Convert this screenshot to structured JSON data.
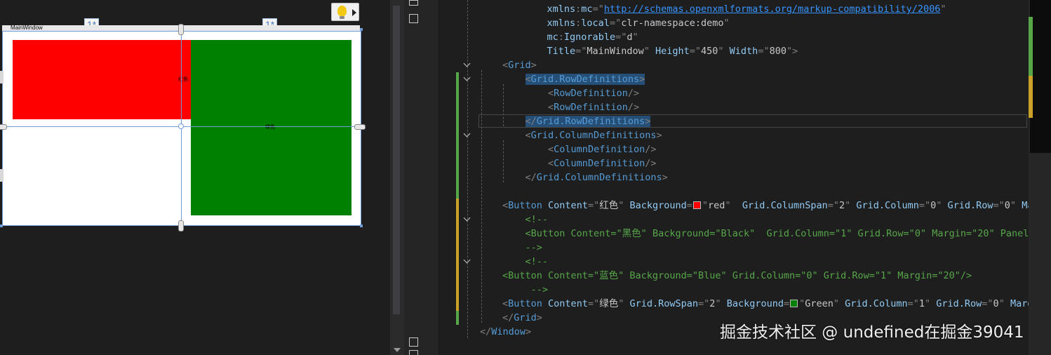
{
  "designer": {
    "window_title": "MainWindow",
    "column_badges": [
      "1*",
      "1*"
    ],
    "red_button_caption": "红色",
    "green_button_caption": "绿色"
  },
  "editor": {
    "lines": [
      [
        [
          "    ",
          "sp"
        ],
        [
          "xmlns",
          "attr"
        ],
        [
          ":",
          "punc"
        ],
        [
          "mc",
          "attr"
        ],
        [
          "=\"",
          "punc"
        ],
        [
          "http://schemas.openxmlformats.org/markup-compatibility/2006",
          "url"
        ],
        [
          "\"",
          "punc"
        ]
      ],
      [
        [
          "    ",
          "sp"
        ],
        [
          "xmlns",
          "attr"
        ],
        [
          ":",
          "punc"
        ],
        [
          "local",
          "attr"
        ],
        [
          "=\"",
          "punc"
        ],
        [
          "clr-namespace:demo",
          "val"
        ],
        [
          "\"",
          "punc"
        ]
      ],
      [
        [
          "    ",
          "sp"
        ],
        [
          "mc",
          "attr"
        ],
        [
          ":",
          "punc"
        ],
        [
          "Ignorable",
          "attr"
        ],
        [
          "=\"",
          "punc"
        ],
        [
          "d",
          "val"
        ],
        [
          "\"",
          "punc"
        ]
      ],
      [
        [
          "    ",
          "sp"
        ],
        [
          "Title",
          "attr"
        ],
        [
          "=\"",
          "punc"
        ],
        [
          "MainWindow",
          "val"
        ],
        [
          "\" ",
          "punc"
        ],
        [
          "Height",
          "attr"
        ],
        [
          "=\"",
          "punc"
        ],
        [
          "450",
          "val"
        ],
        [
          "\" ",
          "punc"
        ],
        [
          "Width",
          "attr"
        ],
        [
          "=\"",
          "punc"
        ],
        [
          "800",
          "val"
        ],
        [
          "\">",
          "punc"
        ]
      ],
      [
        [
          "<",
          "punc"
        ],
        [
          "Grid",
          "tag"
        ],
        [
          ">",
          "punc"
        ]
      ],
      [
        [
          "    ",
          "sp"
        ],
        [
          "<",
          "punc hl"
        ],
        [
          "Grid.RowDefinitions",
          "tag hl"
        ],
        [
          ">",
          "punc hl"
        ]
      ],
      [
        [
          "        ",
          "sp"
        ],
        [
          "<",
          "punc"
        ],
        [
          "RowDefinition",
          "tag"
        ],
        [
          "/>",
          "punc"
        ]
      ],
      [
        [
          "        ",
          "sp"
        ],
        [
          "<",
          "punc"
        ],
        [
          "RowDefinition",
          "tag"
        ],
        [
          "/>",
          "punc"
        ]
      ],
      [
        [
          "    ",
          "sp"
        ],
        [
          "</",
          "punc hl"
        ],
        [
          "Grid.RowDefinitions",
          "tag hl"
        ],
        [
          ">",
          "punc hl"
        ]
      ],
      [
        [
          "    ",
          "sp"
        ],
        [
          "<",
          "punc"
        ],
        [
          "Grid.ColumnDefinitions",
          "tag"
        ],
        [
          ">",
          "punc"
        ]
      ],
      [
        [
          "        ",
          "sp"
        ],
        [
          "<",
          "punc"
        ],
        [
          "ColumnDefinition",
          "tag"
        ],
        [
          "/>",
          "punc"
        ]
      ],
      [
        [
          "        ",
          "sp"
        ],
        [
          "<",
          "punc"
        ],
        [
          "ColumnDefinition",
          "tag"
        ],
        [
          "/>",
          "punc"
        ]
      ],
      [
        [
          "    ",
          "sp"
        ],
        [
          "</",
          "punc"
        ],
        [
          "Grid.ColumnDefinitions",
          "tag"
        ],
        [
          ">",
          "punc"
        ]
      ],
      [],
      [
        [
          "<",
          "punc"
        ],
        [
          "Button",
          "tag"
        ],
        [
          " Content",
          "attr"
        ],
        [
          "=\"",
          "punc"
        ],
        [
          "红色",
          "val"
        ],
        [
          "\" ",
          "punc"
        ],
        [
          "Background",
          "attr"
        ],
        [
          "=",
          "punc"
        ],
        [
          "",
          "swatch-red"
        ],
        [
          "\"",
          "punc"
        ],
        [
          "red",
          "val"
        ],
        [
          "\"  ",
          "punc"
        ],
        [
          "Grid.ColumnSpan",
          "attr"
        ],
        [
          "=\"",
          "punc"
        ],
        [
          "2",
          "val"
        ],
        [
          "\" ",
          "punc"
        ],
        [
          "Grid.Column",
          "attr"
        ],
        [
          "=\"",
          "punc"
        ],
        [
          "0",
          "val"
        ],
        [
          "\" ",
          "punc"
        ],
        [
          "Grid.Row",
          "attr"
        ],
        [
          "=\"",
          "punc"
        ],
        [
          "0",
          "val"
        ],
        [
          "\" ",
          "punc"
        ],
        [
          "Ma",
          "attr"
        ]
      ],
      [
        [
          "    ",
          "sp"
        ],
        [
          "<!--",
          "com"
        ]
      ],
      [
        [
          "    ",
          "sp"
        ],
        [
          "<Button Content=\"黑色\" Background=\"Black\"  Grid.Column=\"1\" Grid.Row=\"0\" Margin=\"20\" Panel",
          "com"
        ]
      ],
      [
        [
          "    ",
          "sp"
        ],
        [
          "-->",
          "com"
        ]
      ],
      [
        [
          "    ",
          "sp"
        ],
        [
          "<!--",
          "com"
        ]
      ],
      [
        [
          "<Button Content=\"蓝色\" Background=\"Blue\" Grid.Column=\"0\" Grid.Row=\"1\" Margin=\"20\"/>",
          "com"
        ]
      ],
      [
        [
          "     ",
          "sp"
        ],
        [
          "-->",
          "com"
        ]
      ],
      [
        [
          "<",
          "punc"
        ],
        [
          "Button",
          "tag"
        ],
        [
          " Content",
          "attr"
        ],
        [
          "=\"",
          "punc"
        ],
        [
          "绿色",
          "val"
        ],
        [
          "\" ",
          "punc"
        ],
        [
          "Grid.RowSpan",
          "attr"
        ],
        [
          "=\"",
          "punc"
        ],
        [
          "2",
          "val"
        ],
        [
          "\" ",
          "punc"
        ],
        [
          "Background",
          "attr"
        ],
        [
          "=",
          "punc"
        ],
        [
          "",
          "swatch-green"
        ],
        [
          "\"",
          "punc"
        ],
        [
          "Green",
          "val"
        ],
        [
          "\" ",
          "punc"
        ],
        [
          "Grid.Column",
          "attr"
        ],
        [
          "=\"",
          "punc"
        ],
        [
          "1",
          "val"
        ],
        [
          "\" ",
          "punc"
        ],
        [
          "Grid.Row",
          "attr"
        ],
        [
          "=\"",
          "punc"
        ],
        [
          "0",
          "val"
        ],
        [
          "\" ",
          "punc"
        ],
        [
          "Marg",
          "attr"
        ]
      ],
      [
        [
          "</",
          "punc"
        ],
        [
          "Grid",
          "tag"
        ],
        [
          ">",
          "punc"
        ]
      ],
      [
        [
          "</",
          "punc"
        ],
        [
          "Window",
          "tag"
        ],
        [
          ">",
          "punc"
        ]
      ]
    ]
  },
  "colors": {
    "red": "#ff0000",
    "green": "#008000",
    "selection": "#264f78"
  },
  "watermark": "掘金技术社区 @ undefined在掘金39041"
}
